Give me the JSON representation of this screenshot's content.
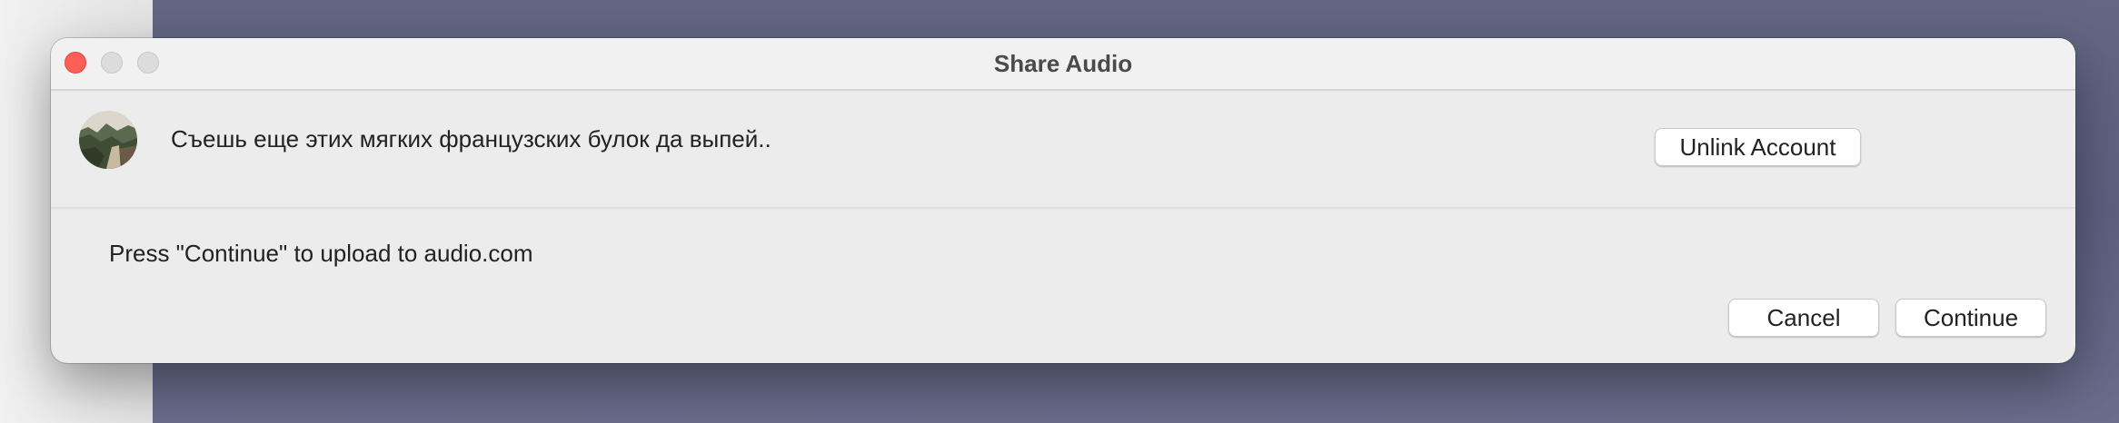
{
  "window": {
    "title": "Share Audio"
  },
  "account": {
    "name": "Съешь еще этих мягких французских булок да выпей..",
    "unlink_label": "Unlink Account"
  },
  "message": "Press \"Continue\" to upload to audio.com",
  "actions": {
    "cancel_label": "Cancel",
    "continue_label": "Continue"
  },
  "colors": {
    "close": "#fe5f57",
    "background": "#5f6383",
    "window": "#ececec"
  }
}
